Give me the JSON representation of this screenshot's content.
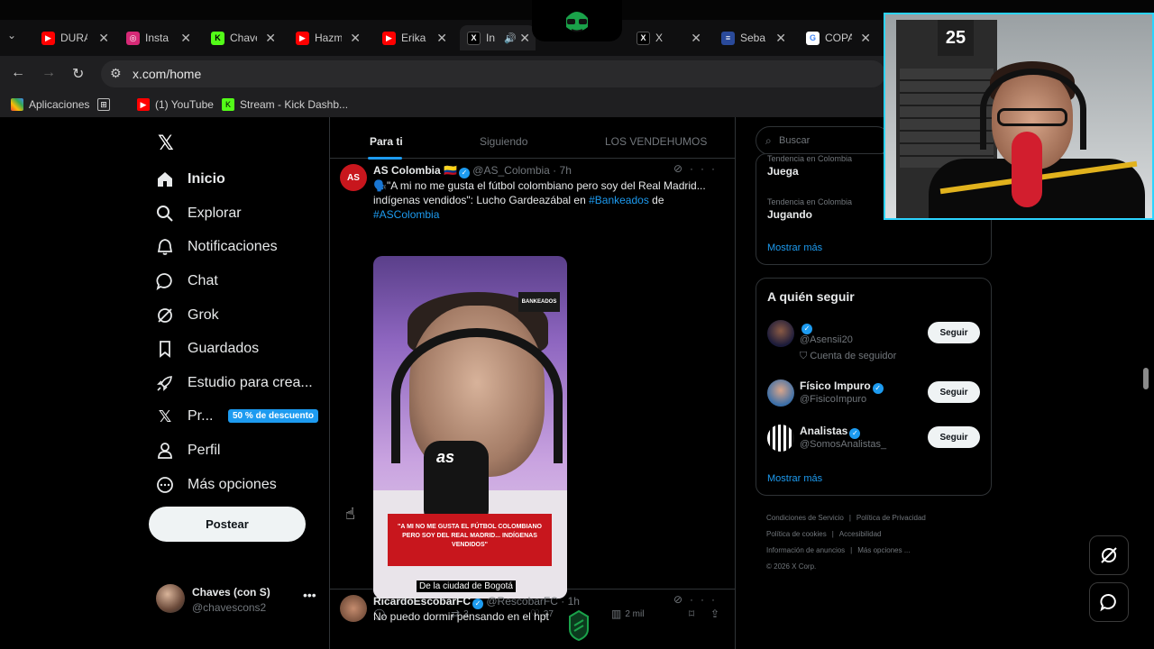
{
  "browser": {
    "tabs": [
      {
        "title": "DURA",
        "favicon": "youtube-icon",
        "color": "#ff0000"
      },
      {
        "title": "Insta",
        "favicon": "instagram-icon",
        "color": "#d62976"
      },
      {
        "title": "Chave",
        "favicon": "kick-icon",
        "color": "#53fc18"
      },
      {
        "title": "Hazm",
        "favicon": "youtube-icon",
        "color": "#ff0000"
      },
      {
        "title": "Erika",
        "favicon": "youtube-icon",
        "color": "#ff0000"
      },
      {
        "title": "In",
        "favicon": "x-icon",
        "color": "#000000",
        "active": true
      },
      {
        "title": "X",
        "favicon": "x-icon",
        "color": "#000000"
      },
      {
        "title": "Seba",
        "favicon": "generic-icon",
        "color": "#2a4a9a"
      },
      {
        "title": "COPA",
        "favicon": "google-icon",
        "color": "#4285f4"
      }
    ],
    "url": "x.com/home",
    "bookmarks": [
      {
        "label": "Aplicaciones",
        "icon": "apps-icon"
      },
      {
        "label": "(1) YouTube",
        "icon": "youtube-icon"
      },
      {
        "label": "Stream - Kick Dashb...",
        "icon": "kick-icon"
      }
    ]
  },
  "nav": {
    "items": [
      {
        "label": "Inicio",
        "icon": "home-icon"
      },
      {
        "label": "Explorar",
        "icon": "search-icon"
      },
      {
        "label": "Notificaciones",
        "icon": "bell-icon"
      },
      {
        "label": "Chat",
        "icon": "chat-icon"
      },
      {
        "label": "Grok",
        "icon": "grok-icon"
      },
      {
        "label": "Guardados",
        "icon": "bookmark-icon"
      },
      {
        "label": "Estudio para crea...",
        "icon": "rocket-icon"
      },
      {
        "label": "Pr...",
        "icon": "x-icon"
      },
      {
        "label": "Perfil",
        "icon": "person-icon"
      },
      {
        "label": "Más opciones",
        "icon": "more-icon"
      }
    ],
    "premium_badge": "50 % de descuento",
    "post_button": "Postear",
    "account": {
      "name": "Chaves (con S)",
      "handle": "@chavescons2"
    }
  },
  "feed": {
    "tabs": [
      "Para ti",
      "Siguiendo",
      "LOS VENDEHUMOS"
    ],
    "tweets": [
      {
        "avatar_text": "AS",
        "name": "AS Colombia 🇨🇴",
        "handle": "@AS_Colombia · 7h",
        "text_prefix": "🗣️\"A mi no me gusta el fútbol colombiano pero soy del Real Madrid... indígenas vendidos\": Lucho Gardeazábal en ",
        "tag1": "#Bankeados",
        "text_mid": " de ",
        "tag2": "#ASColombia",
        "media_caption": "\"A MI NO ME GUSTA EL FÚTBOL COLOMBIANO PERO SOY DEL REAL MADRID... INDÍGENAS VENDIDOS\"",
        "media_subtitle": "De la ciudad de Bogotá",
        "media_mic": "as",
        "media_logo": "BANKEADOS",
        "retweets": "3",
        "likes": "27",
        "views": "2 mil"
      },
      {
        "name": "RicardoEscobarFC",
        "handle": "@RescobarFC · 1h",
        "text": "No puedo dormir pensando en el hpt"
      }
    ]
  },
  "sidebar": {
    "search_placeholder": "Buscar",
    "trends": [
      {
        "category": "Tendencia en Colombia",
        "title": "Juega"
      },
      {
        "category": "Tendencia en Colombia",
        "title": "Jugando"
      }
    ],
    "show_more": "Mostrar más",
    "who_to_follow_title": "A quién seguir",
    "who_to_follow": [
      {
        "name": "",
        "handle": "@Asensii20",
        "note": "Cuenta de seguidor",
        "button": "Seguir"
      },
      {
        "name": "Físico Impuro",
        "handle": "@FisicoImpuro",
        "button": "Seguir"
      },
      {
        "name": "Analistas",
        "handle": "@SomosAnalistas_",
        "button": "Seguir"
      }
    ],
    "footer": [
      "Condiciones de Servicio",
      "Política de Privacidad",
      "Política de cookies",
      "Accesibilidad",
      "Información de anuncios",
      "Más opciones ...",
      "© 2026 X Corp."
    ]
  },
  "webcam": {
    "board_number": "25"
  }
}
